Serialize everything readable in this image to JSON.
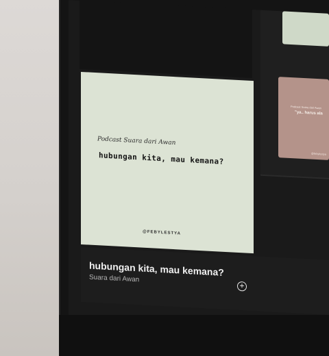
{
  "cover": {
    "pretitle": "Podcast Suara dari Awan",
    "headline": "hubungan kita, mau kemana?",
    "credit": "@FEBYLESTYA"
  },
  "episode": {
    "title": "hubungan kita, mau kemana?",
    "subtitle": "Suara dari Awan",
    "add_icon": "plus-circle-icon"
  },
  "side_card": {
    "line1": "Podcast Suara dari Awan",
    "line2": "\"ya.. harus ala",
    "line3": "@febylestya"
  },
  "colors": {
    "screen_bg": "#1a1a1a",
    "cover_bg": "#dce3d4",
    "pink_card": "#b4938a",
    "top_card": "#cfd9c8"
  }
}
